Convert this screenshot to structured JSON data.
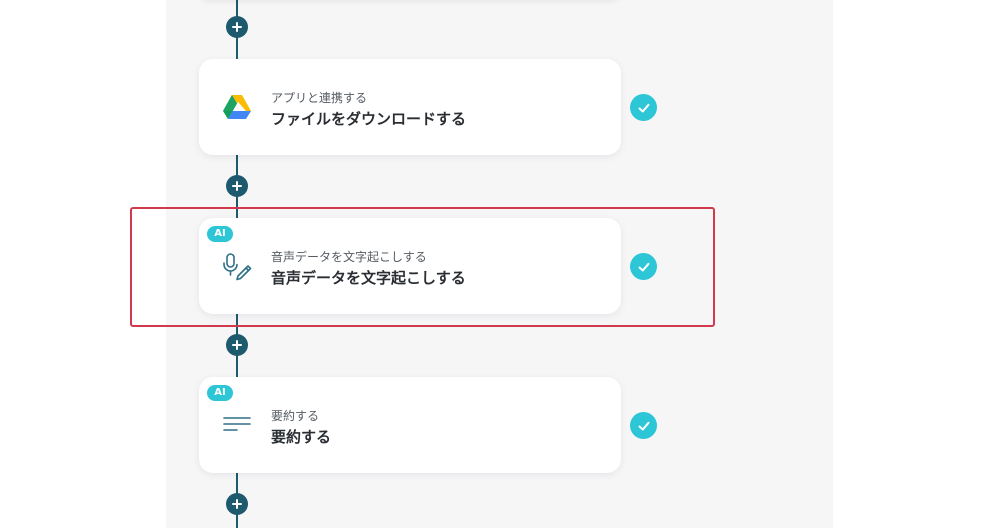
{
  "steps": [
    {
      "subtitle": "アプリと連携する",
      "title": "ファイルをダウンロードする",
      "icon": "google-drive-icon",
      "ai": false,
      "completed": true
    },
    {
      "subtitle": "音声データを文字起こしする",
      "title": "音声データを文字起こしする",
      "icon": "microphone-pen-icon",
      "ai": true,
      "ai_label": "AI",
      "completed": true
    },
    {
      "subtitle": "要約する",
      "title": "要約する",
      "icon": "text-lines-icon",
      "ai": true,
      "ai_label": "AI",
      "completed": true
    }
  ],
  "colors": {
    "flow_line": "#1e5a6e",
    "accent": "#2cc6d6",
    "highlight": "#d03a4c",
    "canvas_bg": "#f6f6f7"
  }
}
